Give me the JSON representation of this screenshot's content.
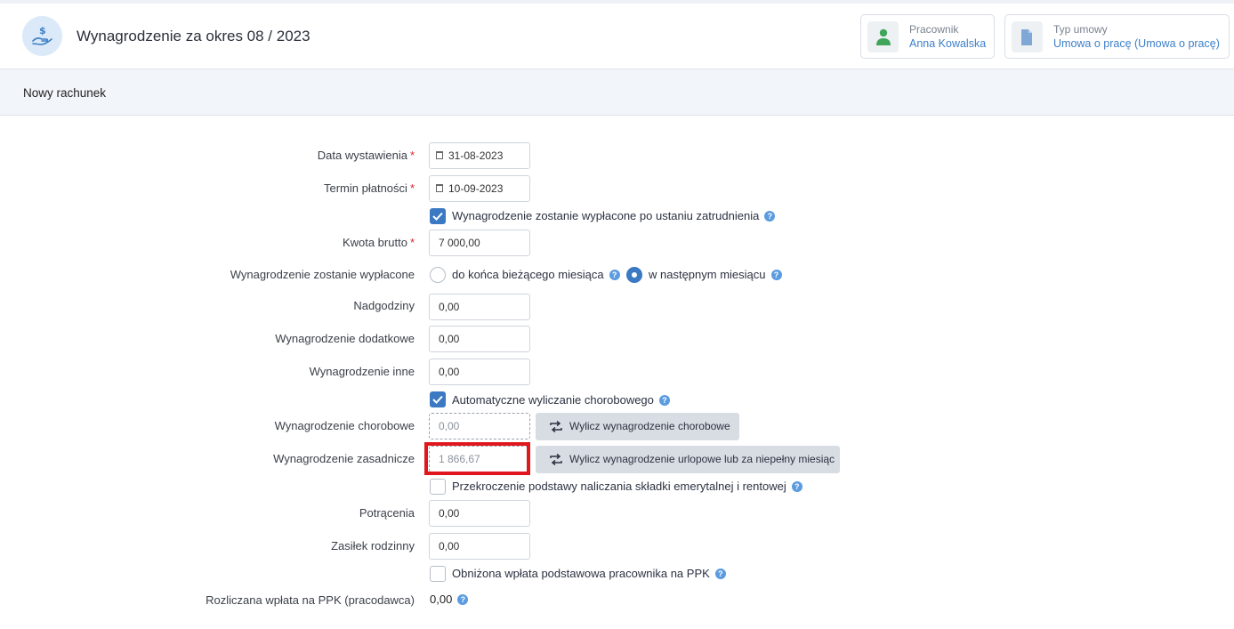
{
  "header": {
    "title": "Wynagrodzenie za okres 08 / 2023",
    "employee": {
      "label": "Pracownik",
      "value": "Anna Kowalska"
    },
    "contract": {
      "label": "Typ umowy",
      "value": "Umowa o pracę (Umowa o pracę)"
    }
  },
  "subheader": {
    "title": "Nowy rachunek"
  },
  "form": {
    "issue_date": {
      "label": "Data wystawienia",
      "required": "*",
      "value": "31-08-2023"
    },
    "payment_due": {
      "label": "Termin płatności",
      "required": "*",
      "value": "10-09-2023"
    },
    "paid_after_employment": {
      "label": "Wynagrodzenie zostanie wypłacone po ustaniu zatrudnienia",
      "checked": true
    },
    "gross_amount": {
      "label": "Kwota brutto",
      "required": "*",
      "value": "7 000,00"
    },
    "payout_timing": {
      "label": "Wynagrodzenie zostanie wypłacone",
      "option_current": "do końca bieżącego miesiąca",
      "option_next": "w następnym miesiącu",
      "selected": "option_next"
    },
    "overtime": {
      "label": "Nadgodziny",
      "value": "0,00"
    },
    "additional_pay": {
      "label": "Wynagrodzenie dodatkowe",
      "value": "0,00"
    },
    "other_pay": {
      "label": "Wynagrodzenie inne",
      "value": "0,00"
    },
    "auto_sick_pay": {
      "label": "Automatyczne wyliczanie chorobowego",
      "checked": true
    },
    "sick_pay": {
      "label": "Wynagrodzenie chorobowe",
      "value": "0,00",
      "button": "Wylicz wynagrodzenie chorobowe"
    },
    "base_pay": {
      "label": "Wynagrodzenie zasadnicze",
      "value": "1 866,67",
      "button": "Wylicz wynagrodzenie urlopowe lub za niepełny miesiąc"
    },
    "contribution_limit": {
      "label": "Przekroczenie podstawy naliczania składki emerytalnej i rentowej",
      "checked": false
    },
    "deductions": {
      "label": "Potrącenia",
      "value": "0,00"
    },
    "family_allowance": {
      "label": "Zasiłek rodzinny",
      "value": "0,00"
    },
    "reduced_ppk": {
      "label": "Obniżona wpłata podstawowa pracownika na PPK",
      "checked": false
    },
    "ppk_employer": {
      "label": "Rozliczana wpłata na PPK (pracodawca)",
      "value": "0,00"
    }
  },
  "help_glyph": "?",
  "colors": {
    "accent": "#3b79c3",
    "highlight": "#e0171c",
    "link": "#3d7fc8"
  }
}
